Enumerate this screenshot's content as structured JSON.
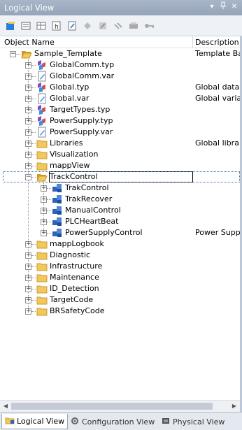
{
  "window": {
    "title": "Logical View",
    "pin_glyph": "▾",
    "dock_glyph": "ᵩ",
    "close_glyph": "✕"
  },
  "toolbar": {
    "buttons": [
      {
        "icon": "add-object-icon"
      },
      {
        "icon": "properties-icon"
      },
      {
        "icon": "table-icon"
      },
      {
        "icon": "header-icon"
      },
      {
        "icon": "variable-icon"
      },
      {
        "icon": "datatype-icon"
      },
      {
        "icon": "edit-icon"
      },
      {
        "icon": "link-icon"
      },
      {
        "icon": "transfer-icon"
      },
      {
        "icon": "key-icon"
      }
    ]
  },
  "columns": {
    "name": "Object Name",
    "description": "Description"
  },
  "tree": [
    {
      "label": "Sample_Template",
      "icon": "folder-open",
      "level": 0,
      "expander": "minus",
      "desc": "Template Ba"
    },
    {
      "label": "GlobalComm.typ",
      "icon": "typ",
      "level": 1,
      "expander": "plus",
      "desc": ""
    },
    {
      "label": "GlobalComm.var",
      "icon": "var",
      "level": 1,
      "expander": "plus",
      "desc": ""
    },
    {
      "label": "Global.typ",
      "icon": "typ",
      "level": 1,
      "expander": "plus",
      "desc": "Global data t"
    },
    {
      "label": "Global.var",
      "icon": "var",
      "level": 1,
      "expander": "plus",
      "desc": "Global variab"
    },
    {
      "label": "TargetTypes.typ",
      "icon": "typ",
      "level": 1,
      "expander": "plus",
      "desc": ""
    },
    {
      "label": "PowerSupply.typ",
      "icon": "typ",
      "level": 1,
      "expander": "plus",
      "desc": ""
    },
    {
      "label": "PowerSupply.var",
      "icon": "var",
      "level": 1,
      "expander": "plus",
      "desc": ""
    },
    {
      "label": "Libraries",
      "icon": "folder",
      "level": 1,
      "expander": "plus",
      "desc": "Global librarie"
    },
    {
      "label": "Visualization",
      "icon": "folder",
      "level": 1,
      "expander": "plus",
      "desc": ""
    },
    {
      "label": "mappView",
      "icon": "folder",
      "level": 1,
      "expander": "plus",
      "desc": ""
    },
    {
      "label": "TrackControl",
      "icon": "folder-open",
      "level": 1,
      "expander": "minus",
      "desc": "",
      "selected": true
    },
    {
      "label": "TrakControl",
      "icon": "program",
      "level": 2,
      "expander": "plus",
      "desc": ""
    },
    {
      "label": "TrakRecover",
      "icon": "program",
      "level": 2,
      "expander": "plus",
      "desc": ""
    },
    {
      "label": "ManualControl",
      "icon": "program",
      "level": 2,
      "expander": "plus",
      "desc": ""
    },
    {
      "label": "PLCHeartBeat",
      "icon": "program",
      "level": 2,
      "expander": "plus",
      "desc": ""
    },
    {
      "label": "PowerSupplyControl",
      "icon": "program",
      "level": 2,
      "expander": "plus",
      "desc": "Power Suppl"
    },
    {
      "label": "mappLogbook",
      "icon": "folder",
      "level": 1,
      "expander": "plus",
      "desc": ""
    },
    {
      "label": "Diagnostic",
      "icon": "folder",
      "level": 1,
      "expander": "plus",
      "desc": ""
    },
    {
      "label": "Infrastructure",
      "icon": "folder",
      "level": 1,
      "expander": "plus",
      "desc": ""
    },
    {
      "label": "Maintenance",
      "icon": "folder",
      "level": 1,
      "expander": "plus",
      "desc": ""
    },
    {
      "label": "ID_Detection",
      "icon": "folder",
      "level": 1,
      "expander": "plus",
      "desc": ""
    },
    {
      "label": "TargetCode",
      "icon": "folder",
      "level": 1,
      "expander": "plus",
      "desc": ""
    },
    {
      "label": "BRSafetyCode",
      "icon": "folder",
      "level": 1,
      "expander": "plus",
      "desc": ""
    }
  ],
  "tabs": [
    {
      "label": "Logical View",
      "icon": "logical-view-icon",
      "active": true
    },
    {
      "label": "Configuration View",
      "icon": "configuration-view-icon",
      "active": false
    },
    {
      "label": "Physical View",
      "icon": "physical-view-icon",
      "active": false
    }
  ],
  "colors": {
    "folder": "#f2c75c",
    "folder_dark": "#c99a2e",
    "typ_purple": "#7a55c0",
    "var_blue": "#3f8ee0",
    "program_blue": "#2e63b8",
    "accent": "#3a6ea5"
  }
}
